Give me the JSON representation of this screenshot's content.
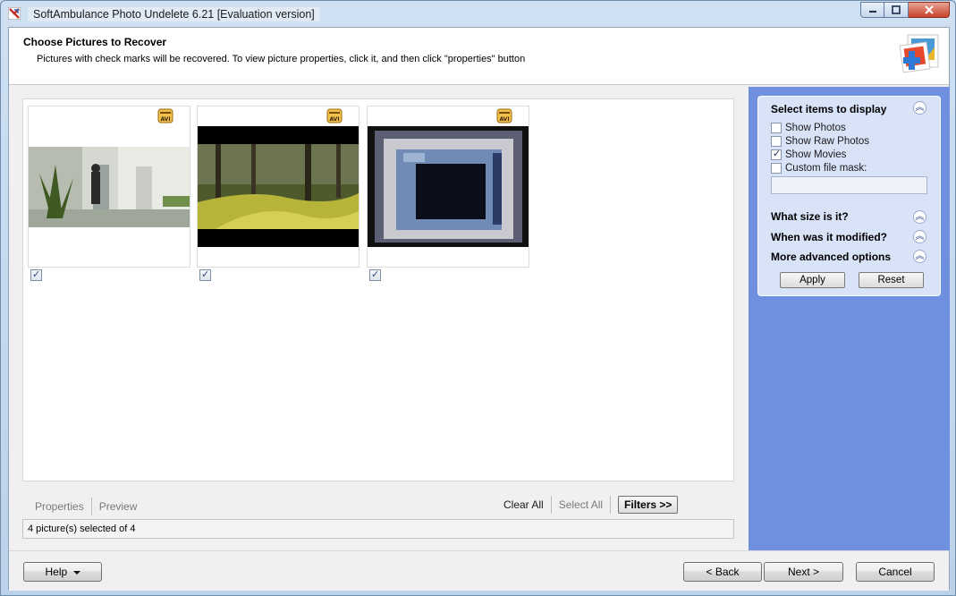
{
  "window": {
    "title": "SoftAmbulance Photo Undelete 6.21 [Evaluation version]"
  },
  "header": {
    "title": "Choose Pictures to Recover",
    "subtitle": "Pictures with check marks will be recovered. To view picture properties, click it, and then click \"properties\" button"
  },
  "gallery": {
    "items": [
      {
        "badge": "AVI",
        "checked": true,
        "scene": "hallway-with-plant"
      },
      {
        "badge": "AVI",
        "checked": true,
        "scene": "forest-path"
      },
      {
        "badge": "AVI",
        "checked": true,
        "scene": "computer-monitor"
      }
    ]
  },
  "actions": {
    "properties": "Properties",
    "preview": "Preview",
    "clear_all": "Clear All",
    "select_all": "Select All",
    "filters": "Filters >>"
  },
  "status": {
    "text": "4 picture(s) selected of 4"
  },
  "filters": {
    "select_title": "Select items to display",
    "options": [
      {
        "label": "Show Photos",
        "checked": false
      },
      {
        "label": "Show Raw Photos",
        "checked": false
      },
      {
        "label": "Show Movies",
        "checked": true
      },
      {
        "label": "Custom file mask:",
        "checked": false
      }
    ],
    "mask_value": "",
    "size_title": "What size is it?",
    "modified_title": "When was it modified?",
    "advanced_title": "More advanced options",
    "apply": "Apply",
    "reset": "Reset"
  },
  "footer": {
    "help": "Help",
    "back": "< Back",
    "next": "Next >",
    "cancel": "Cancel"
  },
  "colors": {
    "side_panel": "#6f8fdf",
    "filter_box": "#d9e3f7"
  }
}
